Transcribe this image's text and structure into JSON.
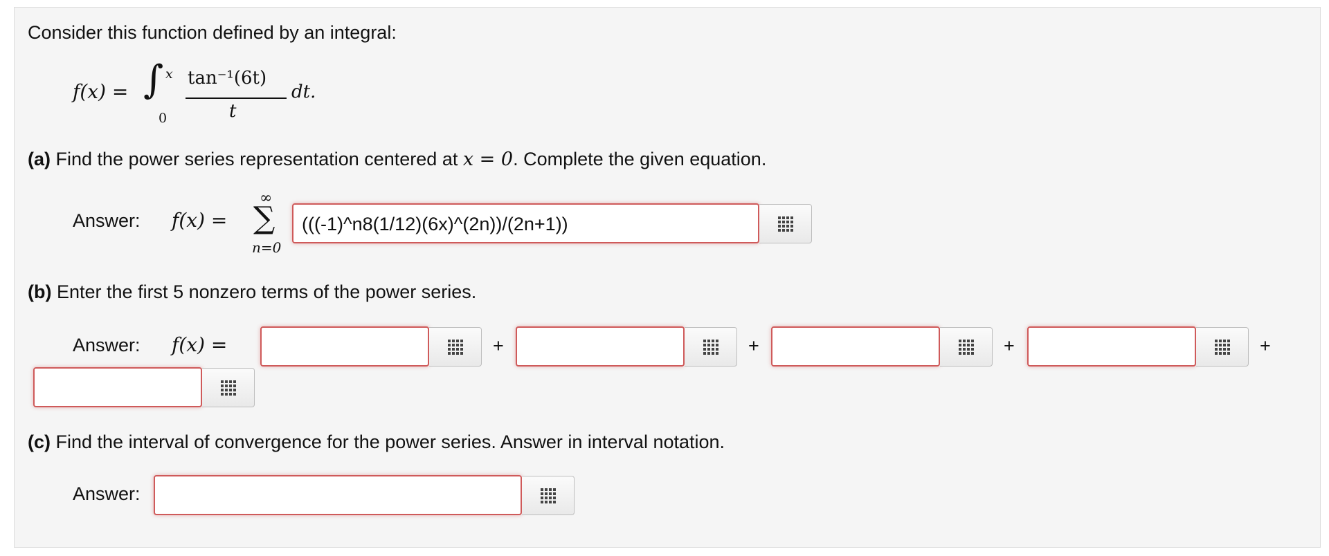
{
  "intro": "Consider this function defined by an integral:",
  "formula": {
    "lhs": "f(x) =",
    "lower_limit": "0",
    "upper_limit": "x",
    "numerator": "tan⁻¹(6t)",
    "denominator": "t",
    "tail": "dt."
  },
  "part_a": {
    "label": "(a)",
    "text_before": "Find the power series representation centered at",
    "inline_math": "x = 0",
    "text_after": ". Complete the given equation.",
    "answer_label": "Answer:",
    "lhs": "f(x) =",
    "sum_upper": "∞",
    "sum_symbol": "∑",
    "sum_lower": "n=0",
    "input_value": "(((-1)^n8(1/12)(6x)^(2n))/(2n+1))"
  },
  "part_b": {
    "label": "(b)",
    "text": "Enter the first 5 nonzero terms of the power series.",
    "answer_label": "Answer:",
    "lhs": "f(x) =",
    "plus": "+",
    "inputs": [
      "",
      "",
      "",
      "",
      ""
    ]
  },
  "part_c": {
    "label": "(c)",
    "text": "Find the interval of convergence for the power series. Answer in interval notation.",
    "answer_label": "Answer:",
    "input_value": ""
  },
  "icons": {
    "keypad": "keypad-grid-icon"
  },
  "colors": {
    "input_border": "#cf5a5a",
    "panel_bg": "#f5f5f5"
  }
}
